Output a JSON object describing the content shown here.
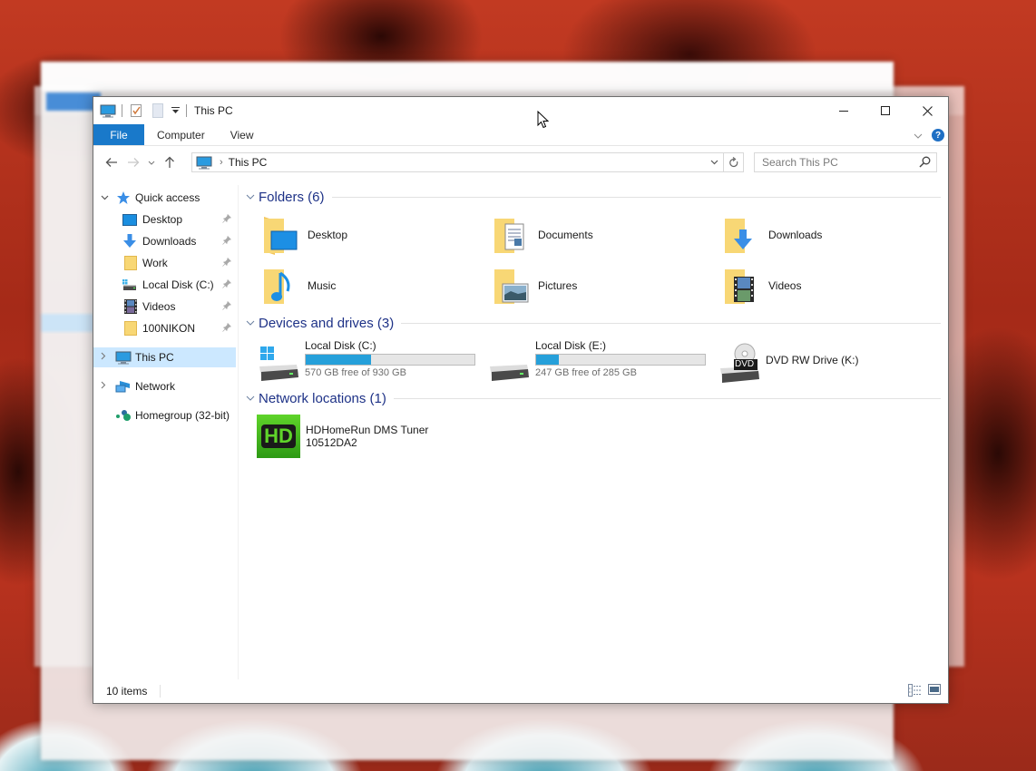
{
  "window": {
    "title": "This PC",
    "controls": {
      "minimize": "—",
      "maximize": "☐",
      "close": "✕"
    }
  },
  "ribbon": {
    "tabs": [
      {
        "label": "File",
        "active": true
      },
      {
        "label": "Computer"
      },
      {
        "label": "View"
      }
    ],
    "help_label": "?"
  },
  "navigation": {
    "back": "←",
    "forward": "→",
    "recent": "⌄",
    "up": "↑",
    "address": {
      "chevron": "›",
      "location": "This PC",
      "dropdown": "⌄"
    },
    "refresh": "↻",
    "search": {
      "placeholder": "Search This PC"
    }
  },
  "sidebar": {
    "quick_access": {
      "label": "Quick access",
      "expander": "⌄",
      "items": [
        {
          "label": "Desktop",
          "icon": "desktop-icon",
          "pinned": true
        },
        {
          "label": "Downloads",
          "icon": "downloads-icon",
          "pinned": true
        },
        {
          "label": "Work",
          "icon": "folder-icon",
          "pinned": true
        },
        {
          "label": "Local Disk (C:)",
          "icon": "drive-icon",
          "pinned": true
        },
        {
          "label": "Videos",
          "icon": "videos-icon",
          "pinned": true
        },
        {
          "label": "100NIKON",
          "icon": "folder-icon",
          "pinned": true
        }
      ]
    },
    "this_pc": {
      "label": "This PC",
      "expander": "›",
      "selected": true
    },
    "network": {
      "label": "Network",
      "expander": "›"
    },
    "homegroup": {
      "label": "Homegroup (32-bit)"
    },
    "pin_glyph": "📌"
  },
  "content": {
    "folders": {
      "title": "Folders (6)",
      "items": [
        {
          "label": "Desktop",
          "icon": "desktop-folder-icon"
        },
        {
          "label": "Documents",
          "icon": "documents-folder-icon"
        },
        {
          "label": "Downloads",
          "icon": "downloads-folder-icon"
        },
        {
          "label": "Music",
          "icon": "music-folder-icon"
        },
        {
          "label": "Pictures",
          "icon": "pictures-folder-icon"
        },
        {
          "label": "Videos",
          "icon": "videos-folder-icon"
        }
      ]
    },
    "devices": {
      "title": "Devices and drives (3)",
      "items": [
        {
          "label": "Local Disk (C:)",
          "free_text": "570 GB free of 930 GB",
          "used_fraction": 0.387,
          "icon": "windows-drive-icon"
        },
        {
          "label": "Local Disk (E:)",
          "free_text": "247 GB free of 285 GB",
          "used_fraction": 0.133,
          "icon": "drive-icon"
        },
        {
          "label": "DVD RW Drive (K:)",
          "icon": "dvd-drive-icon",
          "badge": "DVD"
        }
      ]
    },
    "network": {
      "title": "Network locations (1)",
      "items": [
        {
          "label": "HDHomeRun DMS Tuner",
          "sublabel": "10512DA2",
          "icon": "hdhomerun-icon",
          "badge": "HD"
        }
      ]
    }
  },
  "status": {
    "items_count": "10 items"
  },
  "colors": {
    "accent": "#1979ca",
    "selection": "#cce8ff",
    "group_title": "#1e3287",
    "drive_bar": "#26a0da"
  }
}
